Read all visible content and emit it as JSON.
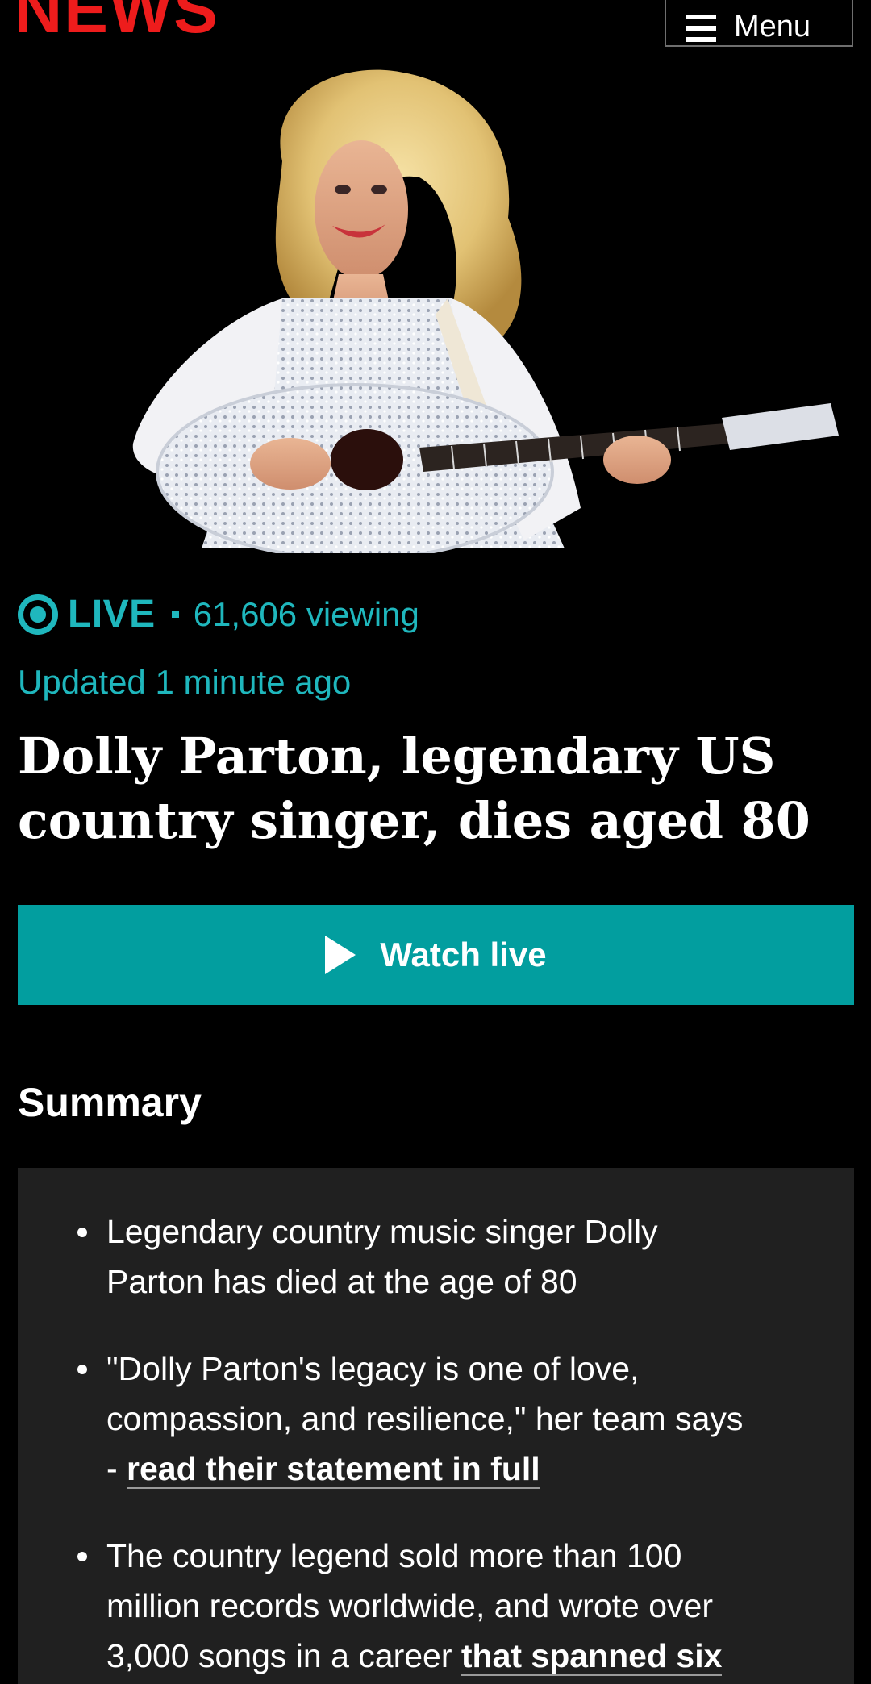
{
  "header": {
    "logo_text": "NEWS",
    "menu_label": "Menu",
    "logo_color": "#ee1c1c"
  },
  "hero_image": {
    "icon": "photo-dolly-parton-guitar"
  },
  "live": {
    "label": "LIVE",
    "viewing": "61,606 viewing",
    "updated": "Updated 1 minute ago",
    "accent_color": "#1fb7bd"
  },
  "headline": {
    "line1": "Dolly Parton, legendary US",
    "line2": "country singer, dies aged 80"
  },
  "watch_button": {
    "label": "Watch live",
    "color": "#029e9f"
  },
  "summary": {
    "heading": "Summary",
    "items": [
      {
        "text_line1": "Legendary country music singer Dolly",
        "text_line2": "Parton has died at the age of 80"
      },
      {
        "text_line1": "\"Dolly Parton's legacy is one of love,",
        "text_line2": "compassion, and resilience,\" her team says",
        "text_prefix3": "- ",
        "link": "read their statement in full"
      },
      {
        "text_line1": "The country legend sold more than 100",
        "text_line2": "million records worldwide, and wrote over",
        "text_prefix3": "3,000 songs in a career ",
        "link": "that spanned six"
      }
    ]
  }
}
